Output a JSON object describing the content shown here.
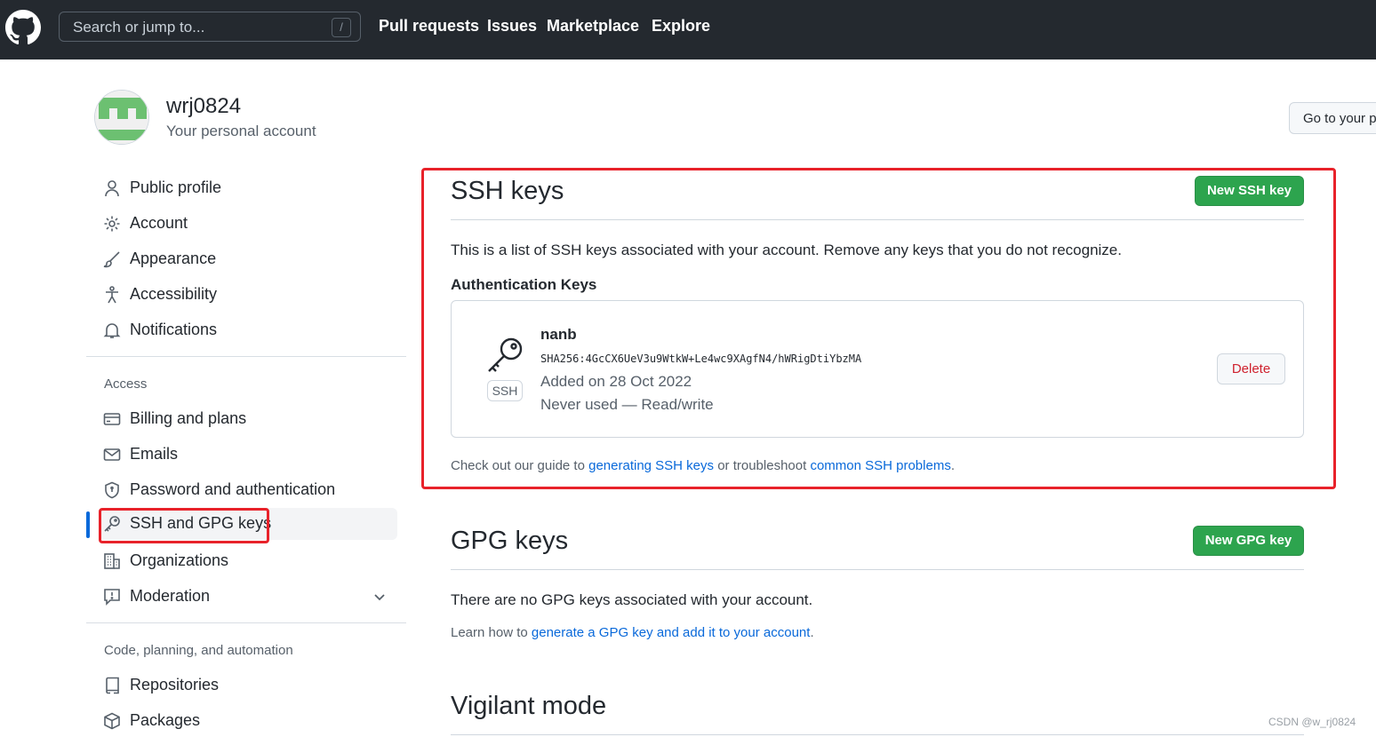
{
  "header": {
    "logo_icon": "github-mark-icon",
    "search_placeholder": "Search or jump to...",
    "search_shortcut": "/",
    "nav": [
      "Pull requests",
      "Issues",
      "Marketplace",
      "Explore"
    ]
  },
  "account": {
    "username": "wrj0824",
    "subtitle": "Your personal account",
    "goto_button": "Go to your personal profile"
  },
  "sidebar": {
    "items_top": [
      {
        "label": "Public profile",
        "icon": "person-icon"
      },
      {
        "label": "Account",
        "icon": "gear-icon"
      },
      {
        "label": "Appearance",
        "icon": "paintbrush-icon"
      },
      {
        "label": "Accessibility",
        "icon": "accessibility-icon"
      },
      {
        "label": "Notifications",
        "icon": "bell-icon"
      }
    ],
    "access_heading": "Access",
    "items_access": [
      {
        "label": "Billing and plans",
        "icon": "credit-card-icon"
      },
      {
        "label": "Emails",
        "icon": "mail-icon"
      },
      {
        "label": "Password and authentication",
        "icon": "shield-lock-icon"
      },
      {
        "label": "SSH and GPG keys",
        "icon": "key-icon",
        "active": true
      },
      {
        "label": "Organizations",
        "icon": "organization-icon"
      },
      {
        "label": "Moderation",
        "icon": "report-icon",
        "expandable": true
      }
    ],
    "code_heading": "Code, planning, and automation",
    "items_code": [
      {
        "label": "Repositories",
        "icon": "repo-icon"
      },
      {
        "label": "Packages",
        "icon": "package-icon"
      }
    ]
  },
  "ssh": {
    "title": "SSH keys",
    "new_button": "New SSH key",
    "description": "This is a list of SSH keys associated with your account. Remove any keys that you do not recognize.",
    "auth_heading": "Authentication Keys",
    "key": {
      "badge": "SSH",
      "title": "nanb",
      "fingerprint": "SHA256:4GcCX6UeV3u9WtkW+Le4wc9XAgfN4/hWRigDtiYbzMA",
      "added": "Added on 28 Oct 2022",
      "usage": "Never used — Read/write",
      "delete_button": "Delete"
    },
    "guide_prefix": "Check out our guide to ",
    "guide_link1": "generating SSH keys",
    "guide_middle": " or troubleshoot ",
    "guide_link2": "common SSH problems",
    "guide_suffix": "."
  },
  "gpg": {
    "title": "GPG keys",
    "new_button": "New GPG key",
    "empty_text": "There are no GPG keys associated with your account.",
    "learn_prefix": "Learn how to ",
    "learn_link": "generate a GPG key and add it to your account",
    "learn_suffix": "."
  },
  "vigilant": {
    "title": "Vigilant mode"
  },
  "watermark": "CSDN @w_rj0824",
  "colors": {
    "header_bg": "#24292f",
    "primary_button": "#2da44e",
    "link": "#0969da",
    "danger": "#cf222e",
    "highlight_box": "#e8222a"
  }
}
